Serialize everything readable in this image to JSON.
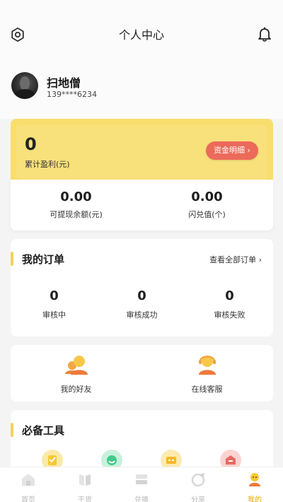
{
  "header": {
    "title": "个人中心",
    "settings_icon": "settings-icon",
    "bell_icon": "bell-icon"
  },
  "profile": {
    "name": "扫地僧",
    "phone": "139****6234"
  },
  "earnings": {
    "amount": "0",
    "label": "累计盈利(元)",
    "button": "资金明细 ›"
  },
  "balances": [
    {
      "value": "0.00",
      "label": "可提现余额(元)"
    },
    {
      "value": "0.00",
      "label": "闪兑值(个)"
    }
  ],
  "orders": {
    "title": "我的订单",
    "link": "查看全部订单 ›",
    "stats": [
      {
        "count": "0",
        "label": "审核中"
      },
      {
        "count": "0",
        "label": "审核成功"
      },
      {
        "count": "0",
        "label": "审核失败"
      }
    ]
  },
  "services": [
    {
      "label": "我的好友",
      "icon": "friends-icon"
    },
    {
      "label": "在线客服",
      "icon": "customer-service-icon"
    }
  ],
  "tools": {
    "title": "必备工具",
    "icons": [
      "tool-yellow-icon",
      "tool-green-icon",
      "tool-orange-icon",
      "tool-red-icon"
    ]
  },
  "tabs": [
    {
      "label": "首页",
      "icon": "home-icon",
      "active": false
    },
    {
      "label": "干货",
      "icon": "book-icon",
      "active": false
    },
    {
      "label": "兑换",
      "icon": "exchange-icon",
      "active": false
    },
    {
      "label": "分享",
      "icon": "share-icon",
      "active": false
    },
    {
      "label": "我的",
      "icon": "profile-icon",
      "active": true
    }
  ],
  "colors": {
    "accent_yellow": "#f9dd6d",
    "button_red": "#ec6a5a",
    "active_tab": "#e6a700"
  }
}
